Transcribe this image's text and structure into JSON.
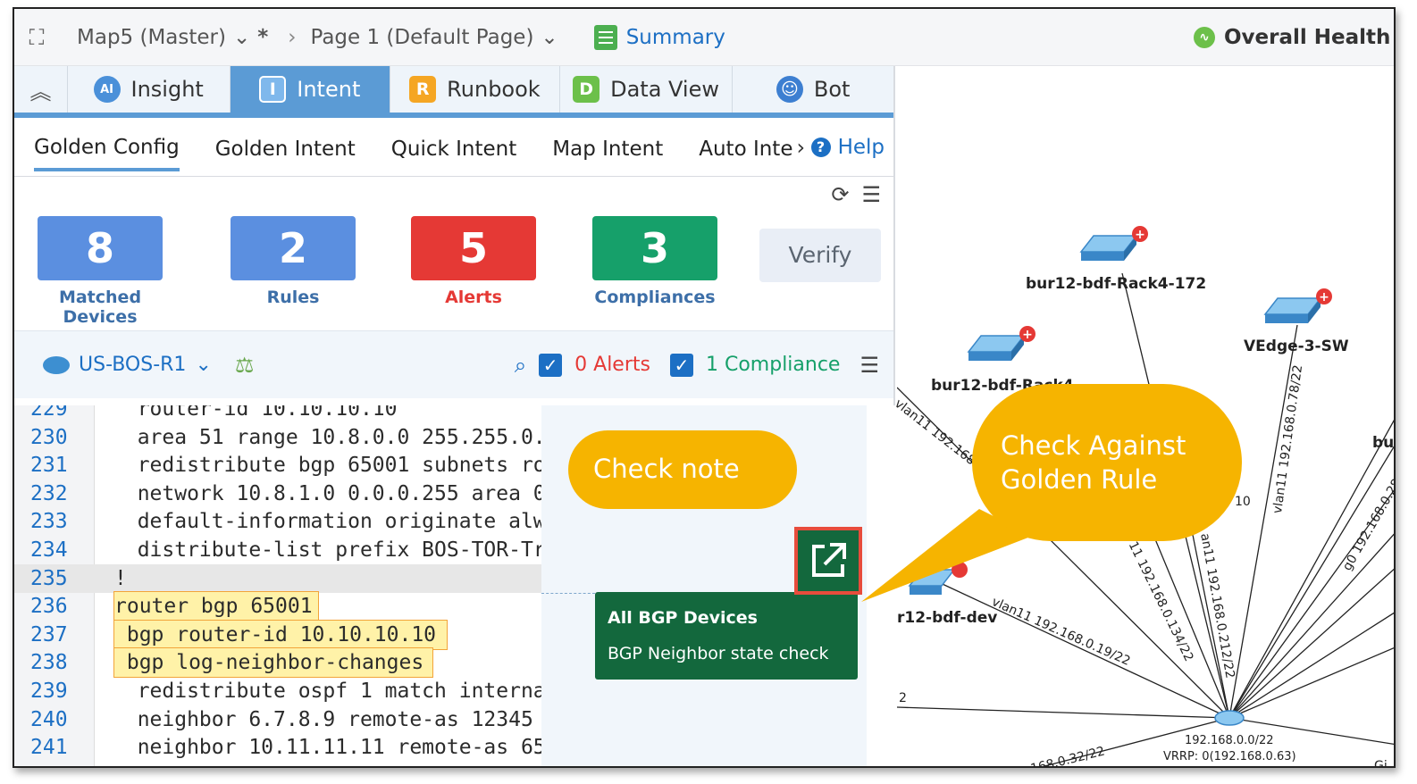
{
  "topbar": {
    "map_name": "Map5 (Master)",
    "unsaved_mark": "*",
    "page_name": "Page 1  (Default Page)",
    "summary_label": "Summary",
    "health_label": "Overall Health V"
  },
  "tabs": [
    {
      "label": "Insight",
      "icon": "ai-robot-icon"
    },
    {
      "label": "Intent",
      "icon": "intent-icon"
    },
    {
      "label": "Runbook",
      "icon": "runbook-icon"
    },
    {
      "label": "Data View",
      "icon": "data-view-icon"
    },
    {
      "label": "Bot",
      "icon": "bot-icon"
    }
  ],
  "subtabs": {
    "items": [
      "Golden Config",
      "Golden Intent",
      "Quick Intent",
      "Map Intent",
      "Auto Inte"
    ],
    "help_label": "Help"
  },
  "stats": {
    "matched": {
      "value": "8",
      "label": "Matched Devices",
      "color": "#5b8fe0"
    },
    "rules": {
      "value": "2",
      "label": "Rules",
      "color": "#5b8fe0"
    },
    "alerts": {
      "value": "5",
      "label": "Alerts",
      "color": "#e53935"
    },
    "compliances": {
      "value": "3",
      "label": "Compliances",
      "color": "#16a06a"
    },
    "verify_label": "Verify"
  },
  "devicebar": {
    "device": "US-BOS-R1",
    "alerts_label": "0 Alerts",
    "compliance_label": "1 Compliance"
  },
  "code_lines": [
    {
      "n": "229",
      "text": "  router-id 10.10.10.10"
    },
    {
      "n": "230",
      "text": "  area 51 range 10.8.0.0 255.255.0.0"
    },
    {
      "n": "231",
      "text": "  redistribute bgp 65001 subnets route-map"
    },
    {
      "n": "232",
      "text": "  network 10.8.1.0 0.0.0.255 area 0"
    },
    {
      "n": "233",
      "text": "  default-information originate always"
    },
    {
      "n": "234",
      "text": "  distribute-list prefix BOS-TOR-Tr"
    },
    {
      "n": "235",
      "text": "!"
    },
    {
      "n": "236",
      "text": "router bgp 65001"
    },
    {
      "n": "237",
      "text": " bgp router-id 10.10.10.10"
    },
    {
      "n": "238",
      "text": " bgp log-neighbor-changes"
    },
    {
      "n": "239",
      "text": "  redistribute ospf 1 match internal"
    },
    {
      "n": "240",
      "text": "  neighbor 6.7.8.9 remote-as 12345"
    },
    {
      "n": "241",
      "text": "  neighbor 10.11.11.11 remote-as 65"
    }
  ],
  "bgp_card": {
    "title": "All BGP Devices",
    "subtitle": "BGP Neighbor state check"
  },
  "callouts": {
    "check_note": "Check note",
    "golden_rule_line1": "Check Against",
    "golden_rule_line2": "Golden Rule"
  },
  "map": {
    "nodes": {
      "rack4_172": "bur12-bdf-Rack4-172",
      "vedge": "VEdge-3-SW",
      "rack4": "bur12-bdf-Rack4",
      "bdf_dev": "r12-bdf-dev",
      "bu": "bu",
      "hub_ip": "192.168.0.0/22",
      "hub_vrrp": "VRRP: 0(192.168.0.63)"
    },
    "edges": {
      "vlan11_168": "vlan11 192.168.",
      "vlan11_78": "vlan11 192.168.0.78/22",
      "ten": "10",
      "vlan11_134": "11 192.168.0.134/22",
      "vlan11_212": "an11 192.168.0.212/22",
      "g0": "g0 192.168.0.28/",
      "vlan11_19": "vlan11 192.168.0.19/22",
      "bottom": "168.0.32/22",
      "two": "2",
      "gi": "Gi"
    }
  },
  "colors": {
    "accent": "#5b9bd5",
    "link": "#1c6fc4",
    "callout": "#f6b400",
    "card": "#13683d",
    "highlight_border": "#e74c3c"
  }
}
